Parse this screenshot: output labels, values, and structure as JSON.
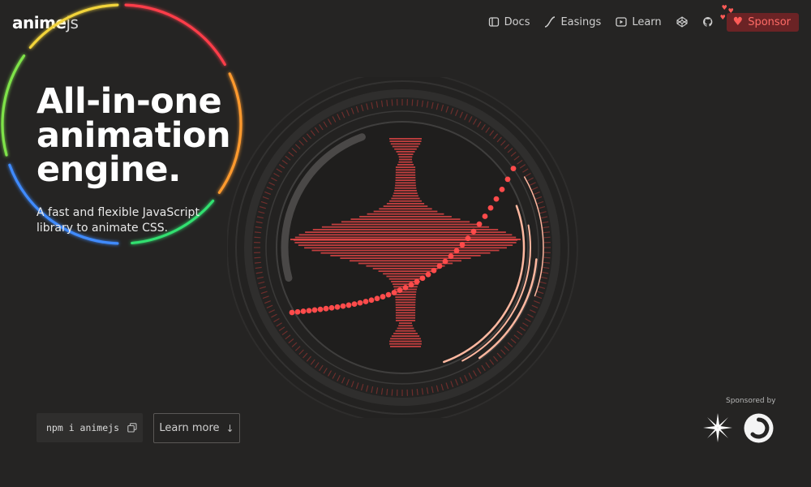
{
  "brand": {
    "name": "anime",
    "suffix": "js"
  },
  "nav": {
    "items": [
      {
        "label": "Docs",
        "icon": "book-icon"
      },
      {
        "label": "Easings",
        "icon": "easing-curve-icon"
      },
      {
        "label": "Learn",
        "icon": "play-icon"
      }
    ],
    "icons": [
      "codepen-icon",
      "github-icon"
    ],
    "sponsor_label": "Sponsor",
    "sponsor_icon": "heart-icon"
  },
  "hero": {
    "title": "All-in-one\nanimation\nengine.",
    "subtitle": "A fast and flexible JavaScript\nlibrary to animate CSS."
  },
  "install": {
    "command": "npm i animejs",
    "icon": "copy-icon"
  },
  "learn_more": {
    "label": "Learn more",
    "icon": "arrow-down-icon"
  },
  "sponsors": {
    "label": "Sponsored by",
    "logos": [
      "star-logo",
      "ring-logo"
    ]
  },
  "colors": {
    "background": "#252423",
    "accent": "#ff4b4b",
    "sponsor_bg": "#6b2325",
    "peach": "#ffb8a0"
  }
}
